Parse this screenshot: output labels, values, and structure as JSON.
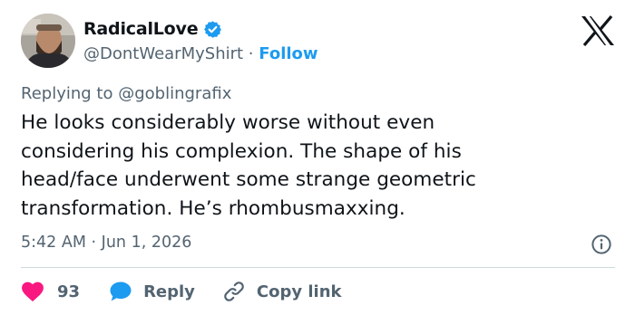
{
  "author": {
    "display_name": "RadicalLove",
    "handle": "@DontWearMyShirt",
    "separator": "·",
    "follow_label": "Follow"
  },
  "reply_context": {
    "prefix": "Replying to",
    "mention": "@goblingrafix"
  },
  "tweet": {
    "text": "He looks considerably worse without even\nconsidering his complexion. The shape of his\nhead/face underwent some strange geometric\ntransformation. He’s rhombusmaxxing."
  },
  "meta": {
    "time": "5:42 AM",
    "separator": "·",
    "date": "Jun 1, 2026"
  },
  "actions": {
    "like_count": "93",
    "reply_label": "Reply",
    "copy_link_label": "Copy link"
  },
  "colors": {
    "accent": "#1d9bf0",
    "like": "#f91880",
    "muted_text": "#536471",
    "divider": "#cfd9de"
  },
  "icons": {
    "verified": "verified-badge-icon",
    "logo": "x-logo-icon",
    "info": "info-icon",
    "like": "heart-icon",
    "reply": "speech-bubble-icon",
    "copy": "link-icon"
  }
}
